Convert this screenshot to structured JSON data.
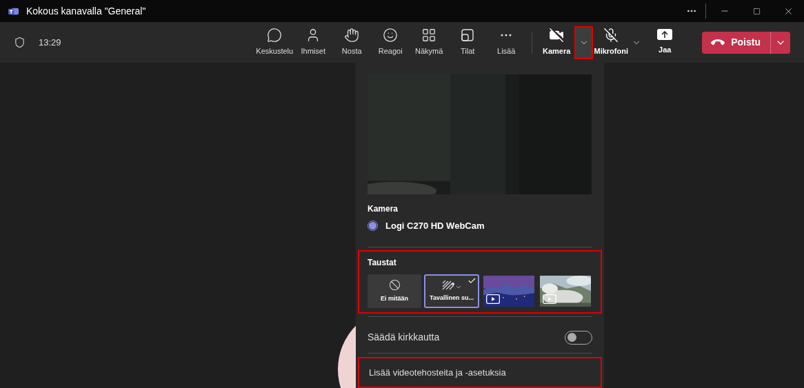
{
  "window": {
    "title": "Kokous kanavalla \"General\""
  },
  "toolbar": {
    "time": "13:29",
    "buttons": [
      {
        "label": "Keskustelu",
        "kind": "chat"
      },
      {
        "label": "Ihmiset",
        "kind": "people"
      },
      {
        "label": "Nosta",
        "kind": "hand"
      },
      {
        "label": "Reagoi",
        "kind": "react"
      },
      {
        "label": "Näkymä",
        "kind": "view"
      },
      {
        "label": "Tilat",
        "kind": "rooms"
      },
      {
        "label": "Lisää",
        "kind": "more"
      }
    ],
    "camera": {
      "label": "Kamera",
      "dropdown_highlighted": true
    },
    "microphone": {
      "label": "Mikrofoni"
    },
    "share": {
      "label": "Jaa"
    },
    "leave": {
      "label": "Poistu"
    }
  },
  "camera_menu": {
    "camera_heading": "Kamera",
    "devices": [
      {
        "name": "Logi C270 HD WebCam",
        "selected": true
      }
    ],
    "backgrounds": {
      "heading": "Taustat",
      "highlighted": true,
      "items": [
        {
          "kind": "none",
          "label": "Ei mitään",
          "selected": false
        },
        {
          "kind": "blur",
          "label": "Tavallinen su...",
          "selected": true
        },
        {
          "kind": "video",
          "selected": false
        },
        {
          "kind": "video",
          "selected": false
        }
      ]
    },
    "brightness": {
      "label": "Säädä kirkkautta",
      "on": false
    },
    "more_settings": {
      "label": "Lisää videotehosteita ja -asetuksia",
      "highlighted": true
    }
  }
}
